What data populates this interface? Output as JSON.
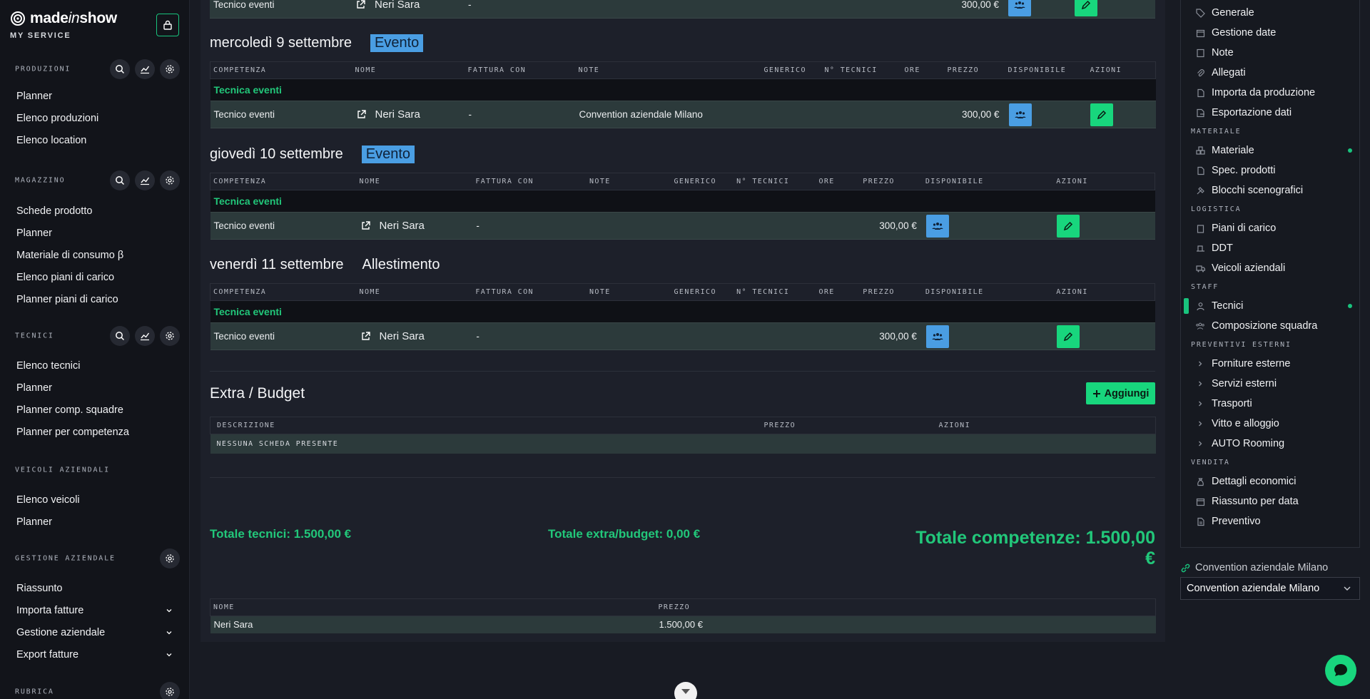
{
  "brand": {
    "name_part1": "made",
    "name_part2": "in",
    "name_part3": "show",
    "service": "MY SERVICE"
  },
  "sidebar": {
    "produzioni": {
      "label": "PRODUZIONI",
      "items": [
        "Planner",
        "Elenco produzioni",
        "Elenco location"
      ]
    },
    "magazzino": {
      "label": "MAGAZZINO",
      "items": [
        "Schede prodotto",
        "Planner",
        "Materiale di consumo β",
        "Elenco piani di carico",
        "Planner piani di carico"
      ]
    },
    "tecnici": {
      "label": "TECNICI",
      "items": [
        "Elenco tecnici",
        "Planner",
        "Planner comp. squadre",
        "Planner per competenza"
      ]
    },
    "veicoli": {
      "label": "VEICOLI AZIENDALI",
      "items": [
        "Elenco veicoli",
        "Planner"
      ]
    },
    "gestione": {
      "label": "GESTIONE AZIENDALE",
      "items": [
        "Riassunto",
        "Importa fatture",
        "Gestione aziendale",
        "Export fatture"
      ]
    },
    "rubrica": {
      "label": "RUBRICA"
    }
  },
  "top_row": {
    "competenza": "Tecnico eventi",
    "nome": "Neri Sara",
    "fattura": "-",
    "prezzo": "300,00 €"
  },
  "days": [
    {
      "title": "mercoledì 9 settembre",
      "badge": "Evento",
      "headers": [
        "COMPETENZA",
        "NOME",
        "FATTURA CON",
        "NOTE",
        "GENERICO",
        "N° TECNICI",
        "ORE",
        "PREZZO",
        "DISPONIBILE",
        "AZIONI"
      ],
      "category": "Tecnica eventi",
      "row": {
        "competenza": "Tecnico eventi",
        "nome": "Neri Sara",
        "fattura": "-",
        "note": "Convention aziendale Milano",
        "prezzo": "300,00 €"
      }
    },
    {
      "title": "giovedì 10 settembre",
      "badge": "Evento",
      "headers": [
        "COMPETENZA",
        "NOME",
        "FATTURA CON",
        "NOTE",
        "GENERICO",
        "N° TECNICI",
        "ORE",
        "PREZZO",
        "DISPONIBILE",
        "AZIONI"
      ],
      "category": "Tecnica eventi",
      "row": {
        "competenza": "Tecnico eventi",
        "nome": "Neri Sara",
        "fattura": "-",
        "note": "",
        "prezzo": "300,00 €"
      }
    },
    {
      "title": "venerdì 11 settembre",
      "badge": "Allestimento",
      "headers": [
        "COMPETENZA",
        "NOME",
        "FATTURA CON",
        "NOTE",
        "GENERICO",
        "N° TECNICI",
        "ORE",
        "PREZZO",
        "DISPONIBILE",
        "AZIONI"
      ],
      "category": "Tecnica eventi",
      "row": {
        "competenza": "Tecnico eventi",
        "nome": "Neri Sara",
        "fattura": "-",
        "note": "",
        "prezzo": "300,00 €"
      }
    }
  ],
  "extra": {
    "title": "Extra / Budget",
    "add_label": "Aggiungi",
    "headers": [
      "DESCRIZIONE",
      "PREZZO",
      "AZIONI"
    ],
    "empty": "NESSUNA SCHEDA PRESENTE"
  },
  "totals": {
    "tecnici": "Totale tecnici: 1.500,00 €",
    "extra": "Totale extra/budget: 0,00 €",
    "competenze": "Totale competenze: 1.500,00 €"
  },
  "summary": {
    "headers": [
      "NOME",
      "PREZZO"
    ],
    "row": {
      "nome": "Neri Sara",
      "prezzo": "1.500,00 €"
    }
  },
  "rightnav": {
    "top": [
      "Generale",
      "Gestione date",
      "Note",
      "Allegati",
      "Importa da produzione",
      "Esportazione dati"
    ],
    "materiale_label": "MATERIALE",
    "materiale": [
      "Materiale",
      "Spec. prodotti",
      "Blocchi scenografici"
    ],
    "logistica_label": "LOGISTICA",
    "logistica": [
      "Piani di carico",
      "DDT",
      "Veicoli aziendali"
    ],
    "staff_label": "STAFF",
    "staff": [
      "Tecnici",
      "Composizione squadra"
    ],
    "preventivi_label": "PREVENTIVI ESTERNI",
    "preventivi": [
      "Forniture esterne",
      "Servizi esterni",
      "Trasporti",
      "Vitto e alloggio",
      "AUTO Rooming"
    ],
    "vendita_label": "VENDITA",
    "vendita": [
      "Dettagli economici",
      "Riassunto per data",
      "Preventivo"
    ]
  },
  "project": {
    "link_label": "Convention aziendale Milano",
    "selected": "Convention aziendale Milano"
  },
  "colors": {
    "accent": "#19c37d",
    "blue": "#4a9ee3",
    "row_bg": "#2c3a3b"
  }
}
